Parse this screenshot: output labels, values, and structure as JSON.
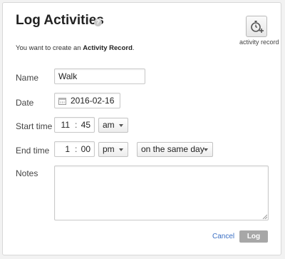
{
  "dialog": {
    "title": "Log Activities",
    "help_icon": "question-icon",
    "record_button": {
      "icon": "stopwatch-plus-icon",
      "label": "activity record"
    },
    "intro": {
      "prefix": "You want to create an ",
      "emphasis": "Activity Record",
      "suffix": "."
    }
  },
  "form": {
    "name": {
      "label": "Name",
      "value": "Walk"
    },
    "date": {
      "label": "Date",
      "value": "2016-02-16",
      "icon": "calendar-icon"
    },
    "start_time": {
      "label": "Start time",
      "hour": "11",
      "separator": ":",
      "minute": "45",
      "ampm": "am"
    },
    "end_time": {
      "label": "End time",
      "hour": "1",
      "separator": ":",
      "minute": "00",
      "ampm": "pm",
      "day": "on the same day"
    },
    "notes": {
      "label": "Notes",
      "value": ""
    }
  },
  "actions": {
    "cancel_label": "Cancel",
    "log_label": "Log"
  },
  "colors": {
    "link": "#3a6fc4",
    "disabled_button": "#a7a7a7"
  }
}
